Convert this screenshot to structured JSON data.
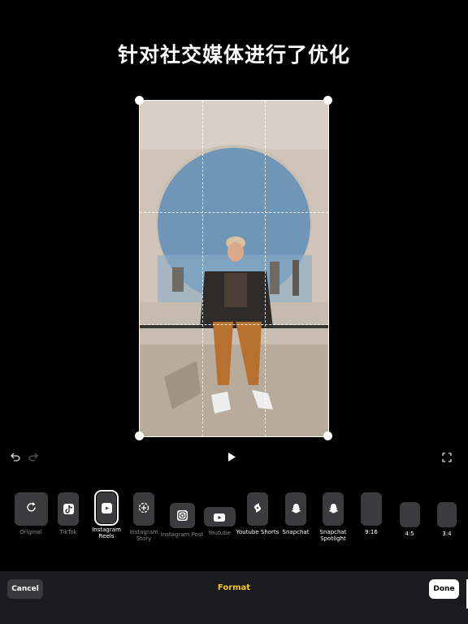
{
  "header": {
    "title": "针对社交媒体进行了优化"
  },
  "controls": {
    "undo_icon": "undo-icon",
    "redo_icon": "redo-icon",
    "play_icon": "play-icon",
    "fullscreen_icon": "fullscreen-icon"
  },
  "formats": [
    {
      "label": "Original",
      "icon": "rotate-icon",
      "selected": false
    },
    {
      "label": "TikTok",
      "icon": "tiktok-icon",
      "selected": false
    },
    {
      "label": "Instagram Reels",
      "icon": "reels-icon",
      "selected": true
    },
    {
      "label": "Instagram Story",
      "icon": "story-icon",
      "selected": false
    },
    {
      "label": "Instagram Post",
      "icon": "instagram-icon",
      "selected": false
    },
    {
      "label": "Youtube",
      "icon": "youtube-icon",
      "selected": false
    },
    {
      "label": "Youtube Shorts",
      "icon": "shorts-icon",
      "selected": false
    },
    {
      "label": "Snapchat",
      "icon": "snapchat-icon",
      "selected": false
    },
    {
      "label": "Snapchat Spotlight",
      "icon": "snapchat-icon",
      "selected": false
    },
    {
      "label": "9:16",
      "icon": "",
      "selected": false
    },
    {
      "label": "4:5",
      "icon": "",
      "selected": false
    },
    {
      "label": "3:4",
      "icon": "",
      "selected": false
    }
  ],
  "bottom_bar": {
    "cancel_label": "Cancel",
    "title": "Format",
    "done_label": "Done"
  },
  "colors": {
    "accent": "#f5c518",
    "background": "#000000",
    "tile": "#3b3b3d"
  }
}
